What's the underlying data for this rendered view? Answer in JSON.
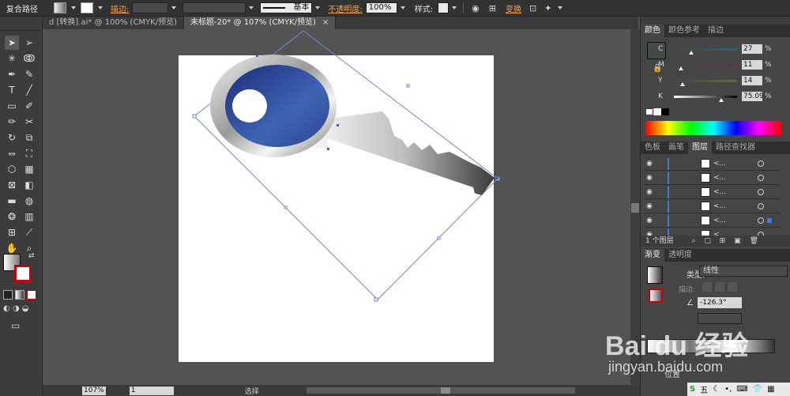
{
  "control_bar": {
    "object_type": "复合路径",
    "stroke_label": "描边:",
    "stroke_style": "基本",
    "opacity_label": "不透明度:",
    "opacity_value": "100%",
    "style_label": "样式:",
    "transform_label": "变换"
  },
  "tabs": [
    {
      "label": "d [转换].ai* @ 100% (CMYK/预览)",
      "active": false
    },
    {
      "label": "未标题-20* @ 107% (CMYK/预览)",
      "active": true,
      "close": "×"
    }
  ],
  "color_panel": {
    "tabs": [
      "颜色",
      "颜色参考",
      "描边"
    ],
    "channels": [
      {
        "name": "C",
        "value": "27",
        "unit": "%"
      },
      {
        "name": "M",
        "value": "11",
        "unit": "%"
      },
      {
        "name": "Y",
        "value": "14",
        "unit": "%"
      },
      {
        "name": "K",
        "value": "75.09",
        "unit": "%"
      }
    ],
    "channel_levels": [
      0.27,
      0.11,
      0.14,
      0.75
    ]
  },
  "layers_panel": {
    "tabs": [
      "色板",
      "画笔",
      "图层",
      "路径查找器"
    ],
    "rows": [
      {
        "name": "<...",
        "selected": false
      },
      {
        "name": "<...",
        "selected": false
      },
      {
        "name": "<...",
        "selected": false
      },
      {
        "name": "<...",
        "selected": false
      },
      {
        "name": "<...",
        "selected": true
      },
      {
        "name": "<...",
        "selected": false
      }
    ],
    "footer": "1 个图层"
  },
  "gradient_panel": {
    "tabs": [
      "渐变",
      "透明度"
    ],
    "type_label": "类型:",
    "type_value": "线性",
    "stroke_label": "描边:",
    "angle_value": "-126.3°",
    "location_label": "位置"
  },
  "status_bar": {
    "zoom": "107%",
    "page": "1",
    "mode": "选择"
  },
  "watermark": {
    "brand": "Bai du 经验",
    "url": "jingyan.baidu.com"
  },
  "ime": {
    "label": "五"
  },
  "colors": {
    "key_blue": "#2d4d9a",
    "accent_orange": "#f2a44a",
    "layer_blue": "#3d7ce0"
  }
}
